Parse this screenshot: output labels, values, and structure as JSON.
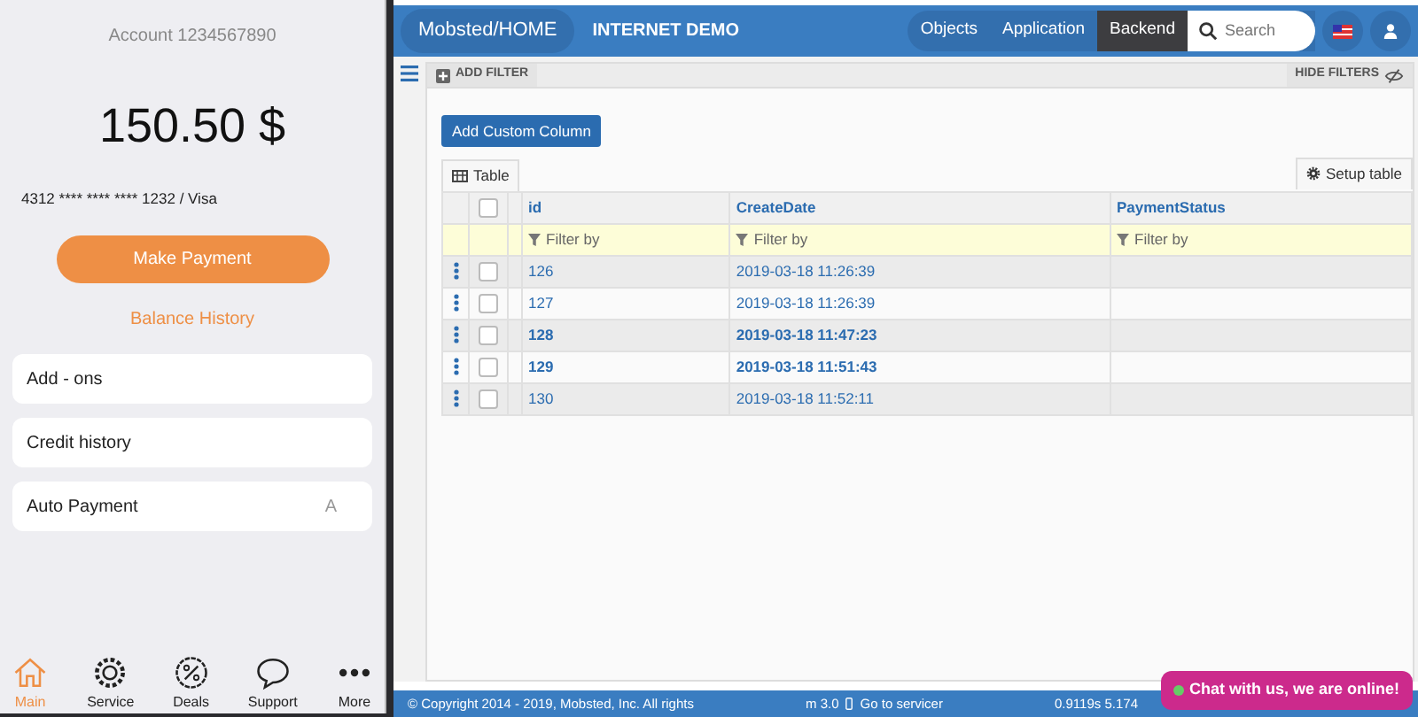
{
  "phone": {
    "account": "Account 1234567890",
    "balance": "150.50 $",
    "card": "4312 **** **** **** 1232 / Visa",
    "pay_button": "Make Payment",
    "history_link": "Balance History",
    "menu": [
      {
        "label": "Add - ons"
      },
      {
        "label": "Credit history"
      },
      {
        "label": "Auto Payment",
        "hint": "A"
      }
    ],
    "tabbar": [
      {
        "label": "Main",
        "kind": "home",
        "selected": true
      },
      {
        "label": "Service",
        "kind": "gear",
        "selected": false
      },
      {
        "label": "Deals",
        "kind": "percent",
        "selected": false
      },
      {
        "label": "Support",
        "kind": "chat",
        "selected": false
      },
      {
        "label": "More",
        "kind": "dots",
        "selected": false
      }
    ]
  },
  "app": {
    "brand": "Mobsted/HOME",
    "title": "INTERNET DEMO",
    "nav": [
      {
        "label": "Objects",
        "selected": false
      },
      {
        "label": "Application",
        "selected": false
      },
      {
        "label": "Backend",
        "selected": true
      }
    ],
    "search": {
      "placeholder": "Search"
    },
    "add_filter": "ADD FILTER",
    "hide_filters": "HIDE FILTERS",
    "add_column_button": "Add Custom Column",
    "view_tab": "Table",
    "setup_button": "Setup table",
    "table": {
      "select_all_checked": false,
      "columns": [
        "id",
        "CreateDate",
        "PaymentStatus"
      ],
      "filters": [
        "Filter by",
        "Filter by",
        "Filter by"
      ],
      "rows": [
        {
          "cells": [
            "126",
            "2019-03-18 11:26:39",
            ""
          ],
          "emphasized": false,
          "checked": false
        },
        {
          "cells": [
            "127",
            "2019-03-18 11:26:39",
            ""
          ],
          "emphasized": false,
          "checked": false
        },
        {
          "cells": [
            "128",
            "2019-03-18 11:47:23",
            ""
          ],
          "emphasized": true,
          "checked": false
        },
        {
          "cells": [
            "129",
            "2019-03-18 11:51:43",
            ""
          ],
          "emphasized": true,
          "checked": false
        },
        {
          "cells": [
            "130",
            "2019-03-18 11:52:11",
            ""
          ],
          "emphasized": false,
          "checked": false
        }
      ]
    },
    "footer": {
      "copyright": "© Copyright 2014 - 2019, Mobsted, Inc. All rights",
      "version": "m 3.0",
      "link": "Go to servicer",
      "timing": "0.9119s 5.174"
    },
    "chat": "Chat with us, we are online!"
  }
}
